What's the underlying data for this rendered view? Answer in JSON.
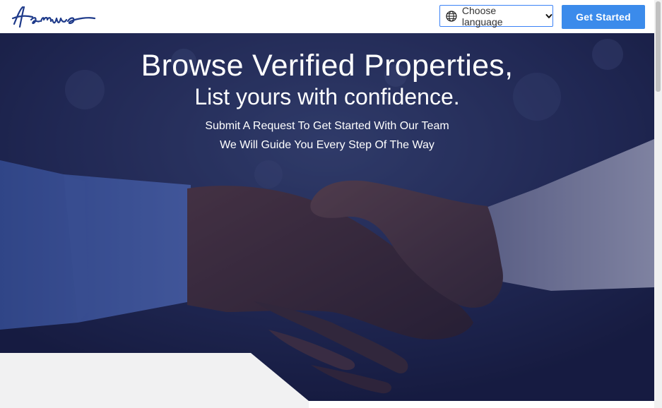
{
  "header": {
    "logo_text": "Hamwe",
    "language_select": {
      "label": "Choose language",
      "icon": "globe-icon"
    },
    "cta_label": "Get Started"
  },
  "hero": {
    "title": "Browse Verified Properties,",
    "subtitle": "List yours with confidence.",
    "line1": "Submit A Request To Get Started With Our Team",
    "line2": "We Will Guide You Every Step Of The Way"
  },
  "colors": {
    "brand": "#1e3a8a",
    "accent": "#3b8beb",
    "hero_overlay": "#1a204a",
    "panel": "#f1f1f1"
  }
}
